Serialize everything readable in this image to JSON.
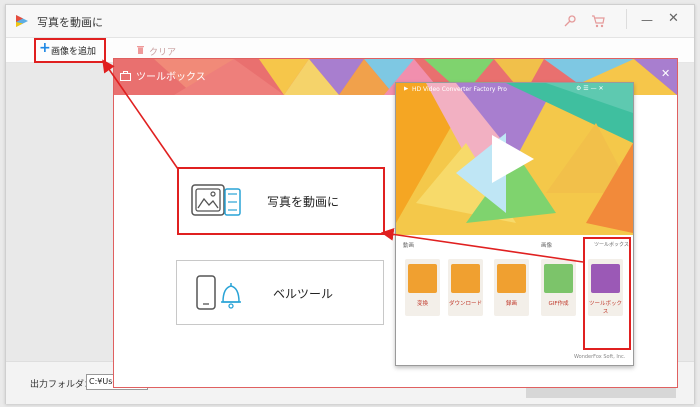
{
  "app": {
    "title": "写真を動画に"
  },
  "toolbar": {
    "add_images": "画像を追加",
    "clear": "クリア"
  },
  "bottom": {
    "output_label": "出力フォルダ：",
    "output_path": "C:¥Users¥"
  },
  "toolbox": {
    "title": "ツールボックス",
    "photo_to_video": "写真を動画に",
    "bell_tool": "ベルツール"
  },
  "mini_app": {
    "title": "HD Video Converter Factory Pro",
    "sections": {
      "video": "動画",
      "image": "画像",
      "toolbox": "ツールボックス"
    },
    "tools": [
      {
        "label": "変換"
      },
      {
        "label": "ダウンロード"
      },
      {
        "label": "録画"
      },
      {
        "label": "GIF作成"
      },
      {
        "label": "ツールボックス"
      }
    ],
    "footer": "WonderFox Soft, Inc."
  },
  "colors": {
    "accent_red": "#e02020",
    "header_red": "#e9706f",
    "icon_orange": "#f0a030",
    "toolbox_purple": "#9b59b6"
  }
}
